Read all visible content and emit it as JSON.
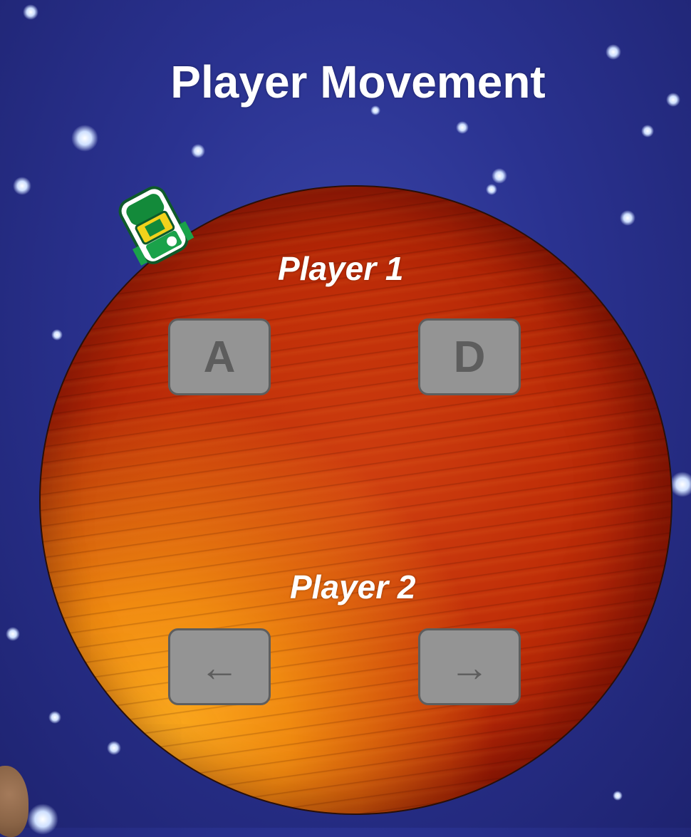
{
  "title": "Player Movement",
  "players": [
    {
      "label": "Player 1",
      "left_key": "A",
      "right_key": "D"
    },
    {
      "label": "Player 2",
      "left_key": "←",
      "right_key": "→"
    }
  ],
  "colors": {
    "background": "#2a3290",
    "planet": "#c02e08",
    "key_face": "#949494",
    "key_text": "#5d5d5d",
    "title_text": "#ffffff"
  },
  "icons": [
    "spaceship-icon",
    "asteroid-icon",
    "planet"
  ]
}
